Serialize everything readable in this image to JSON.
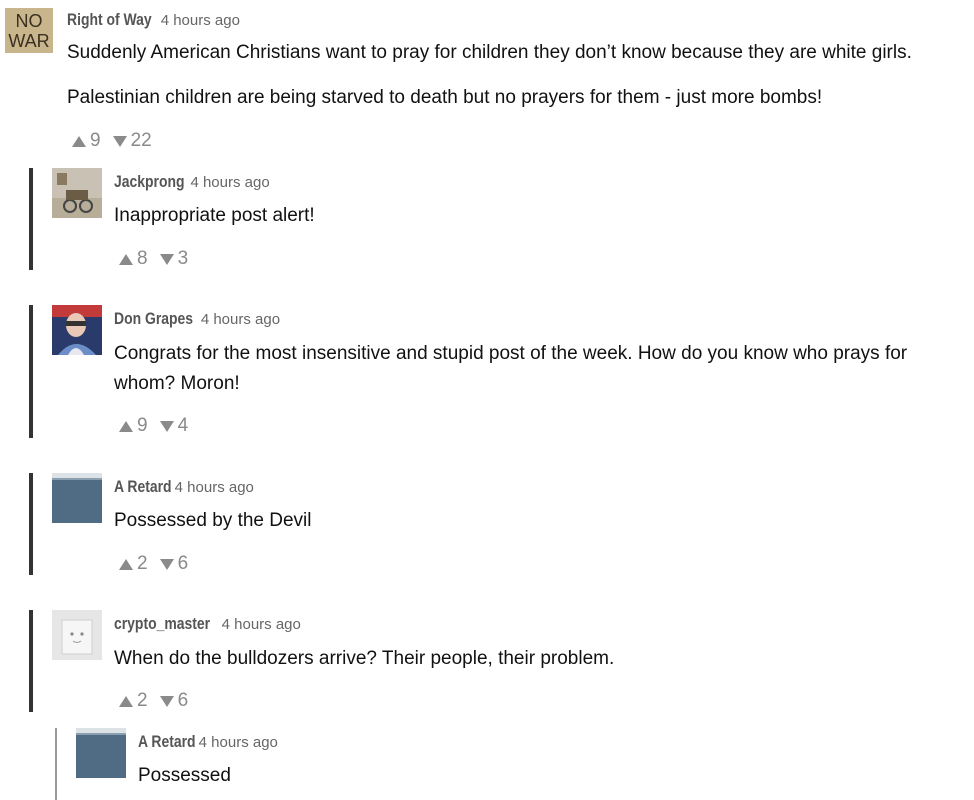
{
  "comments": [
    {
      "author": "Right of Way",
      "time": "4 hours ago",
      "paragraphs": [
        "Suddenly American Christians want to pray for children they don’t know because they are white girls.",
        "Palestinian children are being starved to death but no prayers for them - just more bombs!"
      ],
      "avatar_text": [
        "NO",
        "WAR"
      ],
      "upvotes": "9",
      "downvotes": "22"
    },
    {
      "author": "Jackprong",
      "time": "4 hours ago",
      "paragraphs": [
        "Inappropriate post alert!"
      ],
      "upvotes": "8",
      "downvotes": "3"
    },
    {
      "author": "Don Grapes",
      "time": "4 hours ago",
      "paragraphs": [
        "Congrats for the most insensitive and stupid post of the week. How do you know who prays for whom? Moron!"
      ],
      "upvotes": "9",
      "downvotes": "4"
    },
    {
      "author": "A Retard",
      "time": "4 hours ago",
      "paragraphs": [
        "Possessed by the Devil"
      ],
      "upvotes": "2",
      "downvotes": "6"
    },
    {
      "author": "crypto_master",
      "time": "4 hours ago",
      "paragraphs": [
        "When do the bulldozers arrive? Their people, their problem."
      ],
      "upvotes": "2",
      "downvotes": "6"
    },
    {
      "author": "A Retard",
      "time": "4 hours ago",
      "paragraphs": [
        "Possessed"
      ]
    }
  ],
  "colors": {
    "vote_gray": "#8a8a8a",
    "thread_bar": "#333333",
    "author_gray": "#555555"
  },
  "icons": {
    "upvote": "triangle-up-icon",
    "downvote": "triangle-down-icon"
  }
}
